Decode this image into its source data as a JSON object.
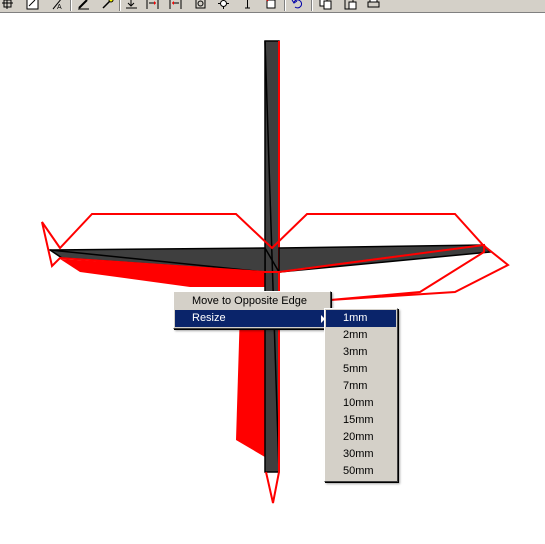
{
  "toolbar": {
    "icons": [
      "move-icon",
      "resize-icon",
      "text-tool-icon",
      "pencil-icon",
      "wand-icon",
      "align-bottom-icon",
      "distribute-h-icon",
      "distribute-v-icon",
      "group-icon",
      "spread-icon",
      "text-cursor-icon",
      "snap-icon",
      "undo-icon",
      "copy-icon",
      "paste-icon",
      "print-icon"
    ]
  },
  "context_menu": {
    "items": [
      {
        "label": "Move to Opposite Edge",
        "selected": false,
        "submenu": false
      },
      {
        "label": "Resize",
        "selected": true,
        "submenu": true
      }
    ]
  },
  "resize_submenu": {
    "items": [
      {
        "label": "1mm",
        "selected": true
      },
      {
        "label": "2mm"
      },
      {
        "label": "3mm"
      },
      {
        "label": "5mm"
      },
      {
        "label": "7mm"
      },
      {
        "label": "10mm"
      },
      {
        "label": "15mm"
      },
      {
        "label": "20mm"
      },
      {
        "label": "30mm"
      },
      {
        "label": "50mm"
      }
    ]
  },
  "colors": {
    "outline": "#ff0000",
    "shape_fill": "#3f3f3f",
    "highlight": "#0a246a",
    "menu_bg": "#d4d0c8"
  }
}
